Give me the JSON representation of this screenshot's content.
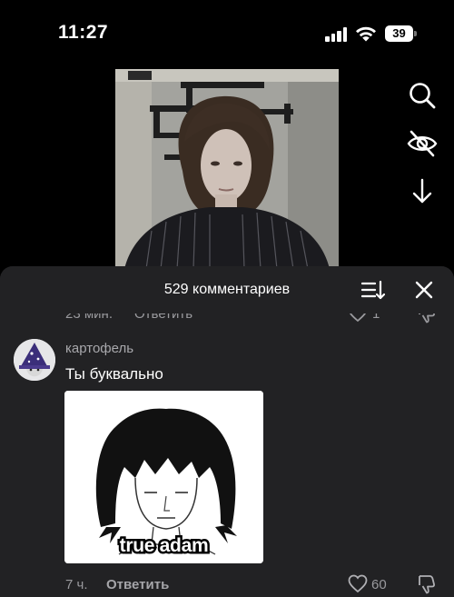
{
  "status_bar": {
    "time": "11:27",
    "battery": "39",
    "icons": [
      "signal-icon",
      "wifi-icon",
      "battery-icon"
    ]
  },
  "side_actions": {
    "icons": [
      "search-icon",
      "hide-eye-icon",
      "download-arrow-icon"
    ]
  },
  "comments_sheet": {
    "title": "529 комментариев",
    "icons": [
      "sort-icon",
      "close-icon"
    ],
    "previous_comment": {
      "time": "23 мин.",
      "reply_label": "Ответить",
      "like_count": "1"
    },
    "comment": {
      "username": "картофель",
      "text": "Ты буквально",
      "image_caption": "true adam",
      "time": "7 ч.",
      "reply_label": "Ответить",
      "like_count": "60"
    }
  },
  "colors": {
    "background": "#000000",
    "sheet": "#222224",
    "secondary_text": "#9a9a9e"
  }
}
